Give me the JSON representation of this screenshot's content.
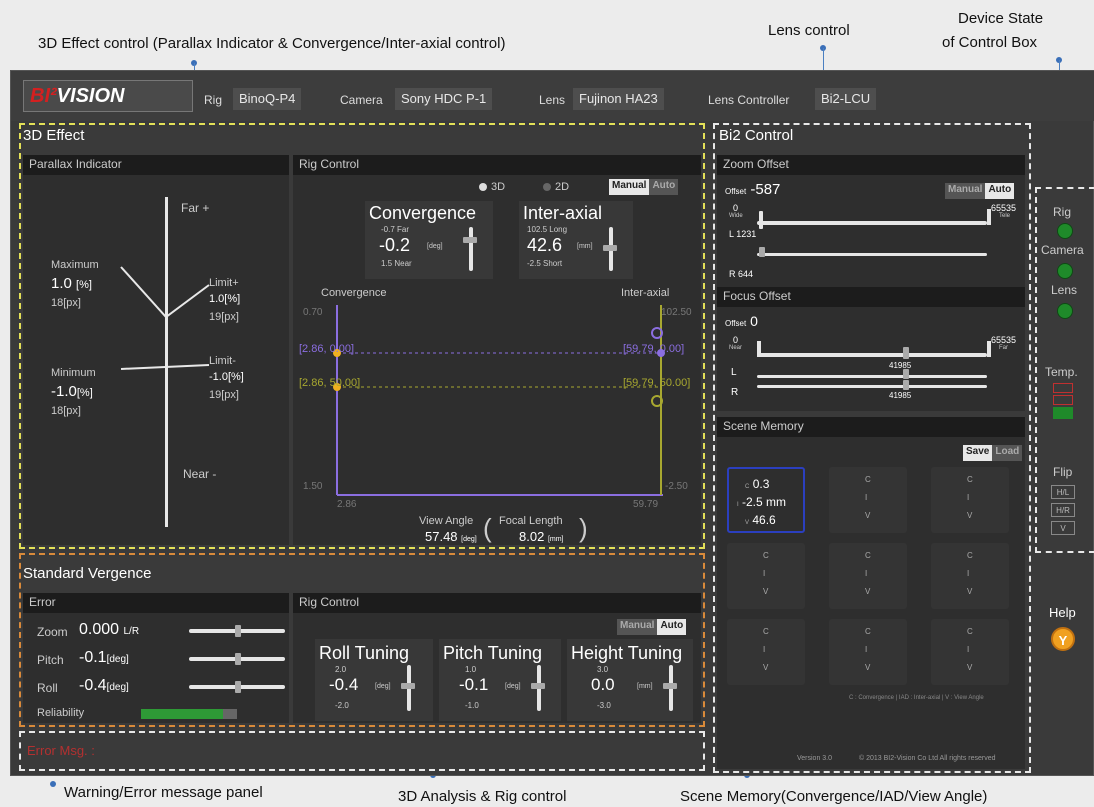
{
  "callouts": {
    "effect3d": "3D Effect control (Parallax  Indicator & Convergence/Inter-axial control)",
    "lens": "Lens control",
    "device_state": "Device State",
    "device_state2": "of Control Box",
    "warning": "Warning/Error message panel",
    "analysis": "3D Analysis & Rig control",
    "scene": "Scene Memory(Convergence/IAD/View  Angle)"
  },
  "topbar": {
    "logo_main": "BI²",
    "logo_rest": "VISION",
    "rig_label": "Rig",
    "rig_value": "BinoQ-P4",
    "camera_label": "Camera",
    "camera_value": "Sony HDC P-1",
    "lens_label": "Lens",
    "lens_value": "Fujinon HA23",
    "lc_label": "Lens Controller",
    "lc_value": "Bi2-LCU"
  },
  "effect3d": {
    "title": "3D Effect",
    "parallax": {
      "header": "Parallax Indicator",
      "far": "Far +",
      "near": "Near -",
      "maximum": "Maximum",
      "max_value": "1.0",
      "max_unit": "[%]",
      "max_px": "18[px]",
      "minimum": "Minimum",
      "min_value": "-1.0",
      "min_unit": "[%]",
      "min_px": "18[px]",
      "limit_plus": "Limit+",
      "limit_plus_value": "1.0[%]",
      "limit_plus_px": "19[px]",
      "limit_minus": "Limit-",
      "limit_minus_value": "-1.0[%]",
      "limit_minus_px": "19[px]"
    },
    "rig": {
      "header": "Rig Control",
      "mode_3d": "3D",
      "mode_2d": "2D",
      "manual": "Manual",
      "auto": "Auto",
      "convergence_title": "Convergence",
      "conv_far": "-0.7 Far",
      "conv_value": "-0.2",
      "conv_unit": "[deg]",
      "conv_near": "1.5 Near",
      "interaxial_title": "Inter-axial",
      "ia_long": "102.5 Long",
      "ia_value": "42.6",
      "ia_unit": "[mm]",
      "ia_short": "-2.5 Short",
      "plot_conv": "Convergence",
      "plot_ia": "Inter-axial",
      "tick_tl": "0.70",
      "tick_tr": "102.50",
      "tick_bl": "1.50",
      "tick_br": "-2.50",
      "tick_xl": "2.86",
      "tick_xr": "59.79",
      "pt_a": "[2.86, 0.00]",
      "pt_b": "[59.79, 0.00]",
      "pt_c": "[2.86, 50.00]",
      "pt_d": "[59.79, 50.00]",
      "view_angle_label": "View Angle",
      "view_angle_value": "57.48",
      "view_angle_unit": "[deg]",
      "focal_label": "Focal Length",
      "focal_value": "8.02",
      "focal_unit": "[mm]"
    }
  },
  "vergence": {
    "title": "Standard Vergence",
    "error_header": "Error",
    "zoom_label": "Zoom",
    "zoom_value": "0.000",
    "zoom_unit": "L/R",
    "pitch_label": "Pitch",
    "pitch_value": "-0.1",
    "pitch_unit": "[deg]",
    "roll_label": "Roll",
    "roll_value": "-0.4",
    "roll_unit": "[deg]",
    "reliability_label": "Reliability",
    "reliability_level": 0.85,
    "rig_header": "Rig Control",
    "manual": "Manual",
    "auto": "Auto",
    "roll_title": "Roll Tuning",
    "roll_top": "2.0",
    "roll_bottom": "-2.0",
    "pitch_title": "Pitch Tuning",
    "pitch_top": "1.0",
    "pitch_bottom": "-1.0",
    "height_title": "Height Tuning",
    "height_top": "3.0",
    "height_value": "0.0",
    "height_unit": "[mm]",
    "height_bottom": "-3.0"
  },
  "bi2": {
    "title": "Bi2 Control",
    "zoom_header": "Zoom Offset",
    "zoom_offset_label": "Offset",
    "zoom_offset_value": "-587",
    "manual": "Manual",
    "auto": "Auto",
    "zoom_min": "0",
    "zoom_min_sub": "Wide",
    "zoom_max": "65535",
    "zoom_max_sub": "Tele",
    "l_label": "L",
    "l_value": "1231",
    "r_label": "R",
    "r_value": "644",
    "focus_header": "Focus Offset",
    "focus_offset_label": "Offset",
    "focus_offset_value": "0",
    "focus_min": "0",
    "focus_min_sub": "Near",
    "focus_max": "65535",
    "focus_max_sub": "Far",
    "focus_l_value": "41985",
    "focus_r_value": "41985",
    "scene_header": "Scene Memory",
    "save": "Save",
    "load": "Load",
    "scene_c": "0.3",
    "scene_i": "-2.5 mm",
    "scene_v": "46.6",
    "letter_c": "C",
    "letter_i": "I",
    "letter_v": "V",
    "scene_footer": "C : Convergence  |  IAD : Inter-axial  |  V : View Angle"
  },
  "device": {
    "rig": "Rig",
    "camera": "Camera",
    "lens": "Lens",
    "temp": "Temp.",
    "flip": "Flip",
    "flip_hl": "H/L",
    "flip_hr": "H/R",
    "flip_v": "V",
    "help": "Help",
    "help_icon": "Y"
  },
  "footer": {
    "error_msg": "Error Msg. :",
    "version": "Version  3.0",
    "copyright": "© 2013 BI2-Vision Co Ltd All rights reserved"
  },
  "colors": {
    "accent_purple": "#8b6ee0",
    "accent_olive": "#a8a830",
    "marker": "#f0b020",
    "led": "#1f8a2a",
    "help": "#f0a020"
  }
}
